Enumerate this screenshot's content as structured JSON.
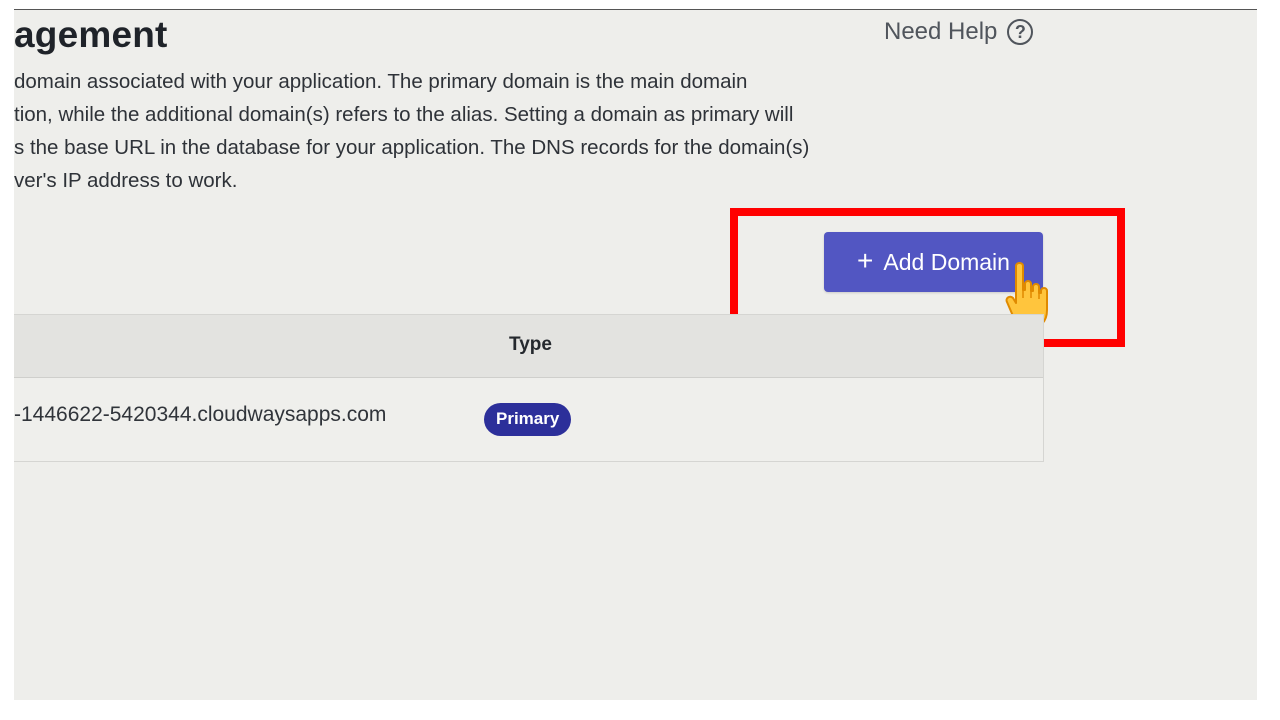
{
  "page": {
    "title": "agement",
    "help_label": "Need Help",
    "description_lines": [
      "domain associated with your application. The primary domain is the main domain",
      "tion, while the additional domain(s) refers to the alias. Setting a domain as primary will",
      "s the base URL in the database for your application. The DNS records for the domain(s)",
      "ver's IP address to work."
    ]
  },
  "actions": {
    "add_domain_label": "Add Domain"
  },
  "table": {
    "columns": [
      "Type"
    ],
    "rows": [
      {
        "domain": "-1446622-5420344.cloudwaysapps.com",
        "type": "Primary"
      }
    ]
  },
  "colors": {
    "accent": "#5256c2",
    "badge": "#2c2f9a",
    "highlight": "#ff0000",
    "background": "#eeeeeb"
  },
  "icons": {
    "help": "question-circle-icon",
    "add": "plus-icon",
    "cursor": "hand-pointer-icon"
  }
}
